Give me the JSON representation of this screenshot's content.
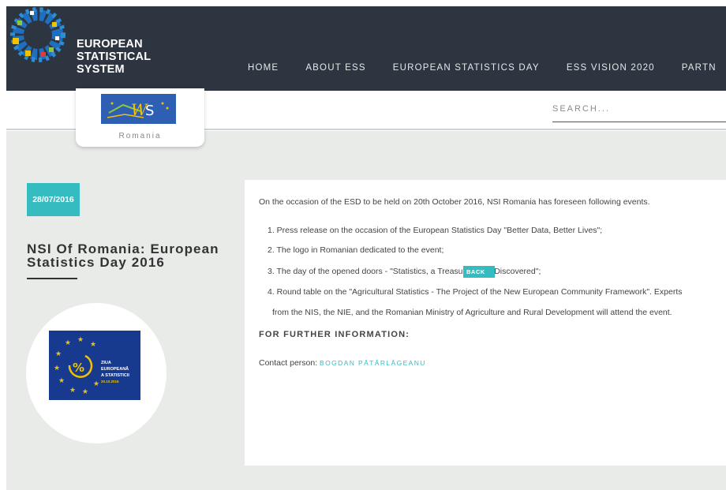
{
  "header": {
    "logo_lines": [
      "EUROPEAN",
      "STATISTICAL",
      "SYSTEM"
    ],
    "nav": [
      "HOME",
      "ABOUT ESS",
      "EUROPEAN STATISTICS DAY",
      "ESS VISION 2020",
      "PARTN"
    ]
  },
  "subbar": {
    "country": "Romania",
    "search_placeholder": "SEARCH..."
  },
  "article": {
    "date": "28/07/2016",
    "title": "NSI Of Romania: European Statistics Day 2016",
    "intro": "On the occasion of the ESD to be held on 20th October 2016, NSI Romania has foreseen following events.",
    "events": [
      "1.  Press release on the occasion of the European Statistics Day \"Better Data, Better Lives\";",
      "2. The logo in Romanian dedicated to the event;",
      "3. The day of the opened doors - \"Statistics, a Treasure to Be Discovered\";",
      "4. Round table on the \"Agricultural Statistics - The Project of the New European Community Framework\". Experts",
      "from the NIS, the NIE, and the Romanian Ministry of Agriculture and Rural Development will attend the event."
    ],
    "further_heading": "FOR FURTHER INFORMATION:",
    "contact_label": "Contact person: ",
    "contact_name": "BOGDAN PĂTÂRLĂGEANU",
    "back_label": "BACK"
  },
  "esd_logo": {
    "lines": [
      "ZIUA",
      "EUROPEANĂ",
      "A STATISTICII",
      "20.10.2016"
    ]
  },
  "colors": {
    "header_bg": "#2d3540",
    "accent": "#35bcc1",
    "page_bg": "#e9ebe9"
  }
}
